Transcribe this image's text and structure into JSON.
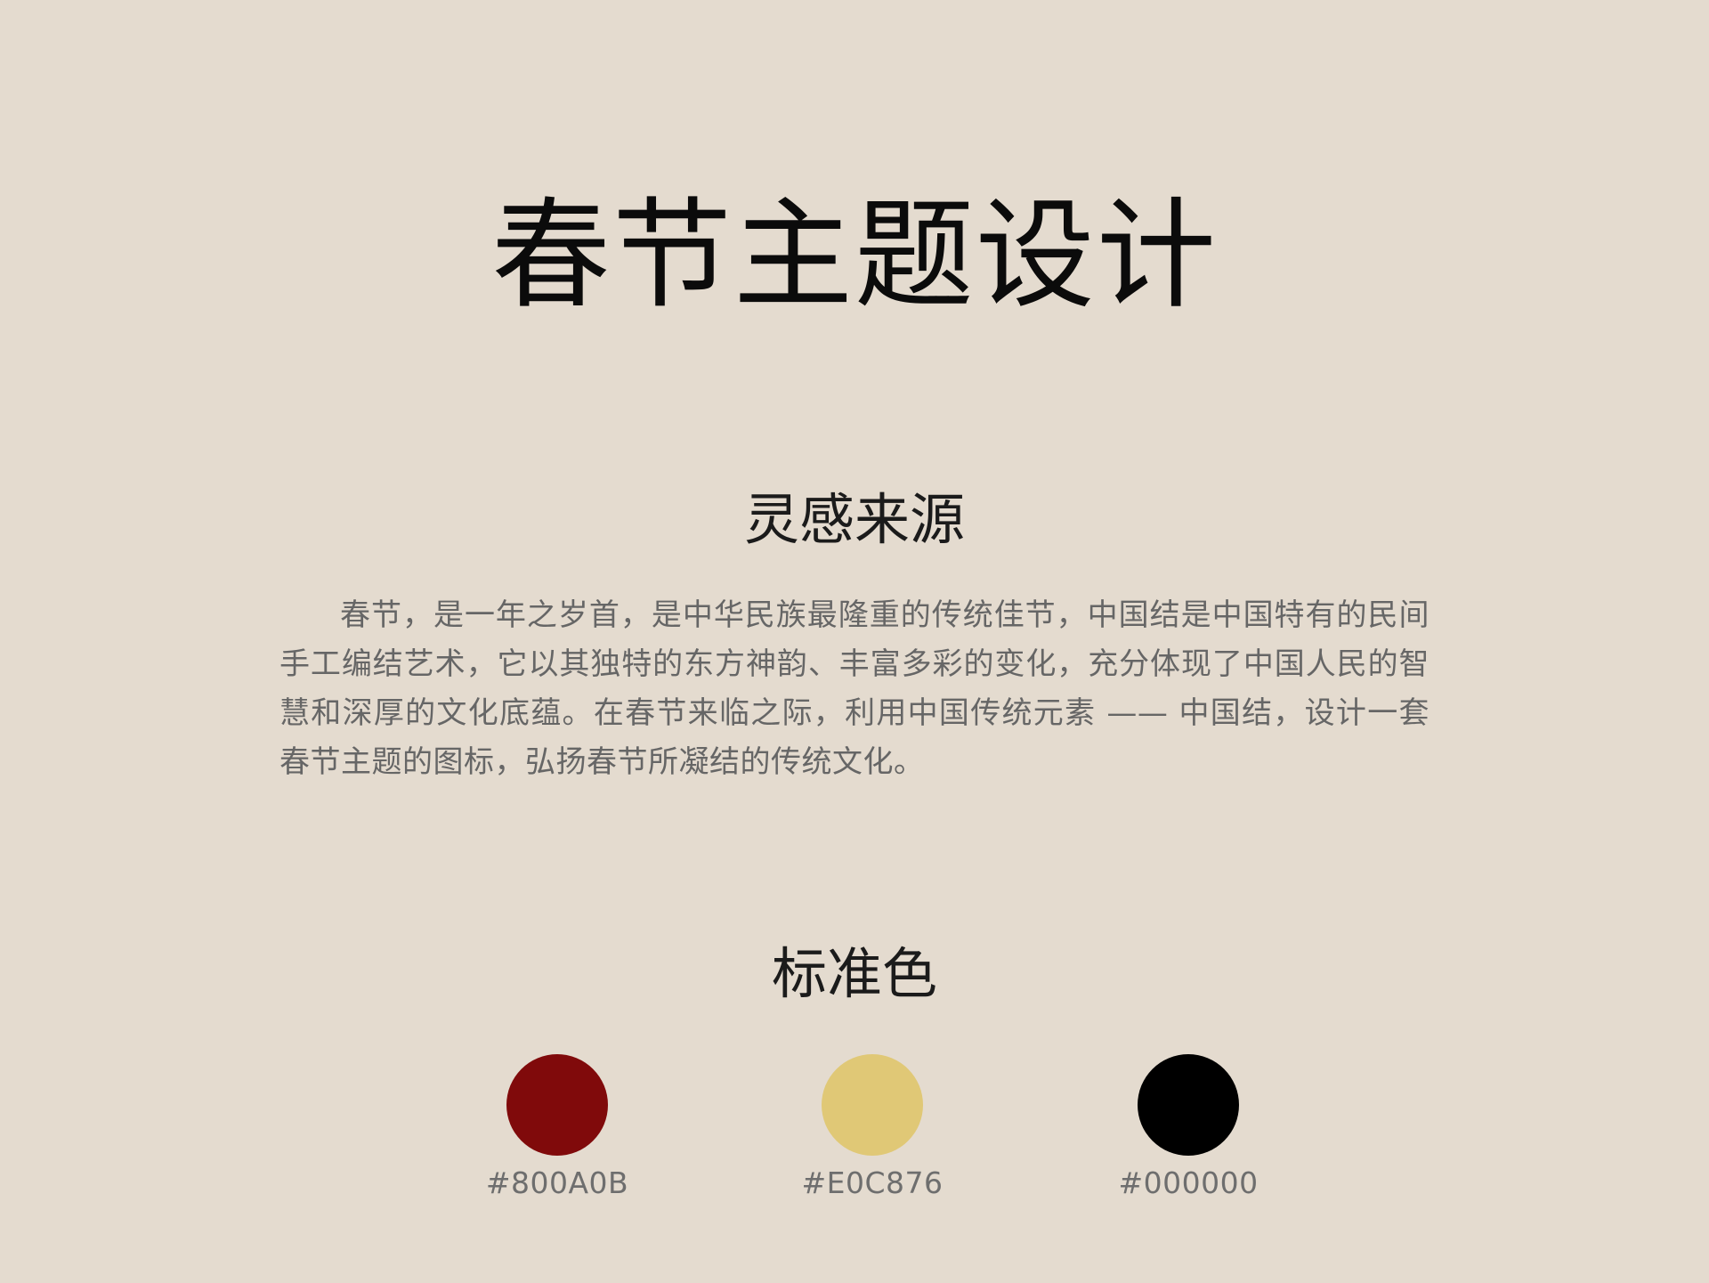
{
  "page": {
    "title": "春节主题设计",
    "background_color": "#E4DBCF"
  },
  "inspiration": {
    "heading": "灵感来源",
    "text": "春节，是一年之岁首，是中华民族最隆重的传统佳节，中国结是中国特有的民间手工编结艺术，它以其独特的东方神韵、丰富多彩的变化，充分体现了中国人民的智慧和深厚的文化底蕴。在春节来临之际，利用中国传统元素 —— 中国结，设计一套春节主题的图标，弘扬春节所凝结的传统文化。"
  },
  "palette": {
    "heading": "标准色",
    "colors": [
      {
        "hex_label": "#800A0B",
        "color": "#800A0B"
      },
      {
        "hex_label": "#E0C876",
        "color": "#E0C876"
      },
      {
        "hex_label": "#000000",
        "color": "#000000"
      }
    ]
  }
}
